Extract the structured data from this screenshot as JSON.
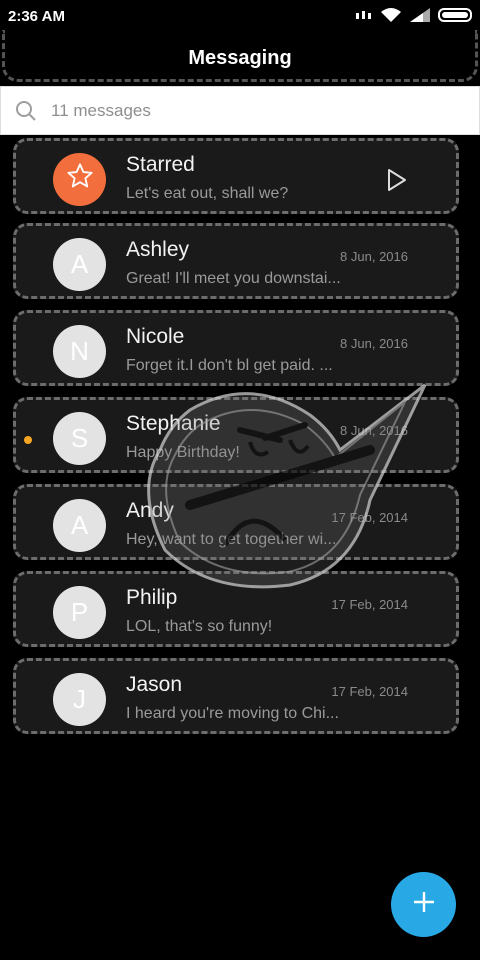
{
  "status_bar": {
    "time": "2:36 AM",
    "icons": [
      "signal-icon",
      "wifi-icon",
      "cellular-icon",
      "battery-icon"
    ]
  },
  "header": {
    "title": "Messaging"
  },
  "search": {
    "placeholder": "11 messages",
    "icon": "search-icon"
  },
  "conversations": [
    {
      "name": "Starred",
      "preview": "Let's eat out, shall we?",
      "date": "",
      "avatar_letter": "",
      "avatar_icon": "star-icon",
      "action_icon": "play-icon",
      "unread": false
    },
    {
      "name": "Ashley",
      "preview": "Great! I'll meet you downstai...",
      "date": "8 Jun, 2016",
      "avatar_letter": "A",
      "unread": false
    },
    {
      "name": "Nicole",
      "preview": "Forget it.I don't bl get paid. ...",
      "date": "8 Jun, 2016",
      "avatar_letter": "N",
      "unread": false
    },
    {
      "name": "Stephanie",
      "preview": "Happy Birthday!",
      "date": "8 Jun, 2016",
      "avatar_letter": "S",
      "unread": true
    },
    {
      "name": "Andy",
      "preview": "Hey, want to get together wi...",
      "date": "17 Feb, 2014",
      "avatar_letter": "A",
      "unread": false
    },
    {
      "name": "Philip",
      "preview": "LOL, that's so funny!",
      "date": "17 Feb, 2014",
      "avatar_letter": "P",
      "unread": false
    },
    {
      "name": "Jason",
      "preview": "I heard you're moving to Chi...",
      "date": "17 Feb, 2014",
      "avatar_letter": "J",
      "unread": false
    }
  ],
  "fab": {
    "icon": "plus-icon"
  },
  "colors": {
    "accent_orange": "#f26e3c",
    "fab_blue": "#29a8e6",
    "unread_dot": "#f6a623",
    "avatar_gray": "#e3e3e3"
  }
}
